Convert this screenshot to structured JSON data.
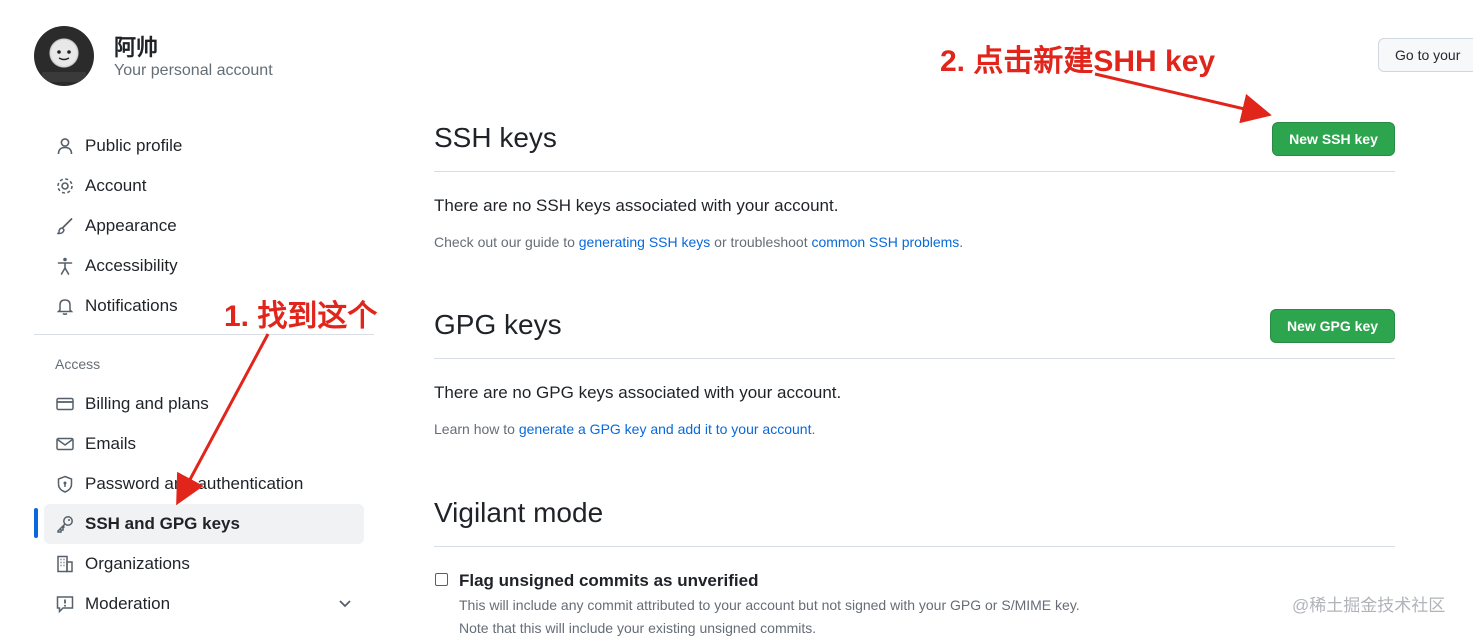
{
  "header": {
    "user_name": "阿帅",
    "user_subtitle": "Your personal account",
    "goto_button": "Go to your"
  },
  "sidebar": {
    "items": [
      {
        "label": "Public profile",
        "icon": "person-icon"
      },
      {
        "label": "Account",
        "icon": "gear-icon"
      },
      {
        "label": "Appearance",
        "icon": "paintbrush-icon"
      },
      {
        "label": "Accessibility",
        "icon": "accessibility-icon"
      },
      {
        "label": "Notifications",
        "icon": "bell-icon"
      }
    ],
    "access_heading": "Access",
    "access_items": [
      {
        "label": "Billing and plans",
        "icon": "credit-card-icon"
      },
      {
        "label": "Emails",
        "icon": "mail-icon"
      },
      {
        "label": "Password and authentication",
        "icon": "shield-icon"
      },
      {
        "label": "SSH and GPG keys",
        "icon": "key-icon",
        "active": true
      },
      {
        "label": "Organizations",
        "icon": "organization-icon"
      },
      {
        "label": "Moderation",
        "icon": "report-icon"
      }
    ]
  },
  "ssh": {
    "title": "SSH keys",
    "button": "New SSH key",
    "empty": "There are no SSH keys associated with your account.",
    "help_prefix": "Check out our guide to ",
    "help_link1": "generating SSH keys",
    "help_mid": " or troubleshoot ",
    "help_link2": "common SSH problems",
    "help_suffix": "."
  },
  "gpg": {
    "title": "GPG keys",
    "button": "New GPG key",
    "empty": "There are no GPG keys associated with your account.",
    "help_prefix": "Learn how to ",
    "help_link": "generate a GPG key and add it to your account",
    "help_suffix": "."
  },
  "vigilant": {
    "title": "Vigilant mode",
    "checkbox_label": "Flag unsigned commits as unverified",
    "checkbox_checked": false,
    "note1": "This will include any commit attributed to your account but not signed with your GPG or S/MIME key.",
    "note2": "Note that this will include your existing unsigned commits."
  },
  "annotations": {
    "step1": "1. 找到这个",
    "step2": "2. 点击新建SHH key"
  },
  "watermark": "@稀土掘金技术社区",
  "colors": {
    "accent": "#0969da",
    "button_green": "#2da44e",
    "annotation_red": "#e1251b"
  }
}
